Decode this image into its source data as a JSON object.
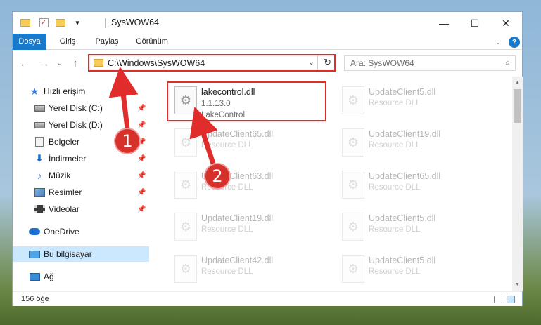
{
  "window": {
    "title": "SysWOW64",
    "minimize_glyph": "—",
    "maximize_glyph": "☐",
    "close_glyph": "✕"
  },
  "quick_access_toolbar": {
    "check_glyph": "✓",
    "dropdown_glyph": "▾"
  },
  "ribbon": {
    "tabs": [
      "Dosya",
      "Giriş",
      "Paylaş",
      "Görünüm"
    ],
    "expand_glyph": "⌄",
    "help_glyph": "?"
  },
  "navigation": {
    "back_glyph": "←",
    "forward_glyph": "→",
    "recent_glyph": "⌄",
    "up_glyph": "↑",
    "address": "C:\\Windows\\SysWOW64",
    "address_dropdown_glyph": "⌄",
    "refresh_glyph": "↻",
    "search_placeholder": "Ara: SysWOW64",
    "search_glyph": "⌕"
  },
  "sidebar": {
    "pin_glyph": "📌",
    "items": [
      {
        "label": "Hızlı erişim",
        "icon": "star-icon",
        "glyph": "★",
        "pinned": false,
        "selected": false
      },
      {
        "label": "Yerel Disk (C:)",
        "icon": "disk-icon",
        "glyph": "",
        "pinned": true,
        "selected": false
      },
      {
        "label": "Yerel Disk (D:)",
        "icon": "disk-icon",
        "glyph": "",
        "pinned": true,
        "selected": false
      },
      {
        "label": "Belgeler",
        "icon": "document-icon",
        "glyph": "",
        "pinned": true,
        "selected": false
      },
      {
        "label": "İndirmeler",
        "icon": "download-icon",
        "glyph": "⬇",
        "pinned": true,
        "selected": false
      },
      {
        "label": "Müzik",
        "icon": "music-icon",
        "glyph": "♪",
        "pinned": true,
        "selected": false
      },
      {
        "label": "Resimler",
        "icon": "pictures-icon",
        "glyph": "",
        "pinned": true,
        "selected": false
      },
      {
        "label": "Videolar",
        "icon": "videos-icon",
        "glyph": "",
        "pinned": true,
        "selected": false
      },
      {
        "label": "OneDrive",
        "icon": "cloud-icon",
        "glyph": "",
        "pinned": false,
        "selected": false
      },
      {
        "label": "Bu bilgisayar",
        "icon": "computer-icon",
        "glyph": "",
        "pinned": false,
        "selected": true
      },
      {
        "label": "Ağ",
        "icon": "network-icon",
        "glyph": "",
        "pinned": false,
        "selected": false
      }
    ]
  },
  "files": [
    {
      "name": "lakecontrol.dll",
      "line2": "1.1.13.0",
      "line3": "LakeControl",
      "highlighted": true
    },
    {
      "name": "UpdateClient5.dll",
      "line2": "Resource DLL",
      "line3": "",
      "highlighted": false
    },
    {
      "name": "UpdateClient65.dll",
      "line2": "Resource DLL",
      "line3": "",
      "highlighted": false
    },
    {
      "name": "UpdateClient19.dll",
      "line2": "Resource DLL",
      "line3": "",
      "highlighted": false
    },
    {
      "name": "UpdateClient63.dll",
      "line2": "Resource DLL",
      "line3": "",
      "highlighted": false
    },
    {
      "name": "UpdateClient65.dll",
      "line2": "Resource DLL",
      "line3": "",
      "highlighted": false
    },
    {
      "name": "UpdateClient19.dll",
      "line2": "Resource DLL",
      "line3": "",
      "highlighted": false
    },
    {
      "name": "UpdateClient5.dll",
      "line2": "Resource DLL",
      "line3": "",
      "highlighted": false
    },
    {
      "name": "UpdateClient42.dll",
      "line2": "Resource DLL",
      "line3": "",
      "highlighted": false
    },
    {
      "name": "UpdateClient5.dll",
      "line2": "Resource DLL",
      "line3": "",
      "highlighted": false
    }
  ],
  "file_icon_glyph": "⚙",
  "scrollbar": {
    "up_glyph": "▲",
    "down_glyph": "▼"
  },
  "status": {
    "item_count": "156 öğe"
  },
  "annotations": {
    "callout_1": "1",
    "callout_2": "2",
    "color": "#e12c2c"
  }
}
